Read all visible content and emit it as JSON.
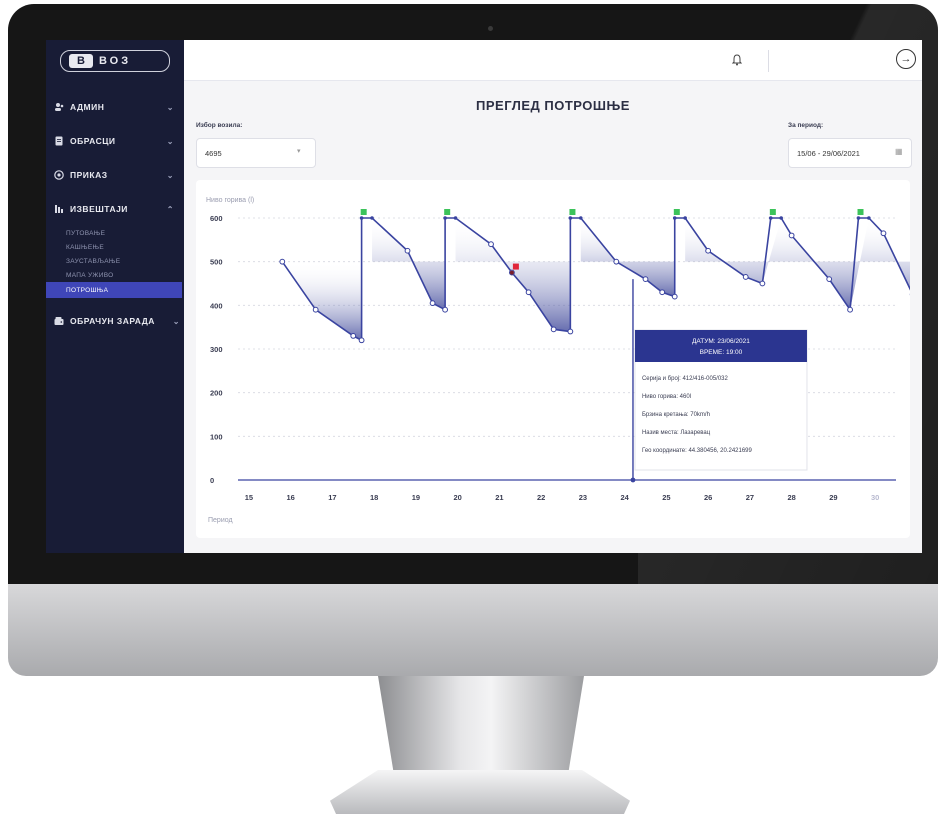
{
  "sidebar": {
    "logo_text": "ВОЗ",
    "items": [
      {
        "label": "АДМИН",
        "icon": "users-icon"
      },
      {
        "label": "ОБРАСЦИ",
        "icon": "document-icon"
      },
      {
        "label": "ПРИКАЗ",
        "icon": "eye-icon"
      },
      {
        "label": "ИЗВЕШТАЈИ",
        "icon": "report-icon"
      },
      {
        "label": "ОБРАЧУН ЗАРАДА",
        "icon": "wallet-icon"
      }
    ],
    "subitems": [
      "ПУТОВАЊЕ",
      "КАШЊЕЊЕ",
      "ЗАУСТАВЉАЊЕ",
      "МАПА УЖИВО",
      "ПОТРОШЊА"
    ],
    "active_subitem": "ПОТРОШЊА"
  },
  "header": {
    "title": "ПРЕГЛЕД ПОТРОШЊЕ",
    "vehicle_label": "Избор возила:",
    "vehicle_value": "4695",
    "period_label": "За период:",
    "period_value": "15/06 - 29/06/2021"
  },
  "colors": {
    "sidebar": "#181c36",
    "accent": "#3f46b8",
    "line": "#3a44a0"
  },
  "chart_data": {
    "type": "line",
    "ylabel": "Ниво горива (l)",
    "xlabel": "Период",
    "ylim": [
      0,
      600
    ],
    "yticks": [
      0,
      100,
      200,
      300,
      400,
      500,
      600
    ],
    "x_ticks": [
      "15",
      "16",
      "17",
      "18",
      "19",
      "20",
      "21",
      "22",
      "23",
      "24",
      "25",
      "26",
      "27",
      "28",
      "29",
      "30"
    ],
    "grid": "horizontal dotted",
    "series": [
      {
        "points": [
          [
            15.8,
            500
          ],
          [
            16.6,
            390
          ],
          [
            17.5,
            330
          ],
          [
            17.7,
            320
          ],
          [
            17.7,
            600
          ],
          [
            17.95,
            600
          ],
          [
            18.8,
            525
          ],
          [
            19.4,
            405
          ],
          [
            19.7,
            390
          ],
          [
            19.7,
            600
          ],
          [
            19.95,
            600
          ],
          [
            20.8,
            540
          ],
          [
            21.3,
            475
          ],
          [
            21.7,
            430
          ],
          [
            22.3,
            345
          ],
          [
            22.7,
            340
          ],
          [
            22.7,
            600
          ],
          [
            22.95,
            600
          ],
          [
            23.8,
            500
          ],
          [
            24.5,
            460
          ],
          [
            24.9,
            430
          ],
          [
            25.2,
            420
          ],
          [
            25.2,
            600
          ],
          [
            25.45,
            600
          ],
          [
            26.0,
            525
          ],
          [
            26.9,
            465
          ],
          [
            27.3,
            450
          ],
          [
            27.5,
            600
          ],
          [
            27.75,
            600
          ],
          [
            28.0,
            560
          ],
          [
            28.9,
            460
          ],
          [
            29.4,
            390
          ],
          [
            29.6,
            600
          ],
          [
            29.85,
            600
          ],
          [
            30.2,
            565
          ],
          [
            30.9,
            425
          ]
        ]
      }
    ],
    "refuel_markers_x": [
      17.75,
      19.75,
      22.75,
      25.25,
      27.55,
      29.65
    ],
    "alert_marker": [
      21.3,
      475
    ],
    "selected_x": 24.2,
    "tooltip": {
      "title_line1": "ДАТУМ: 23/06/2021",
      "title_line2": "ВРЕМЕ: 19:00",
      "rows": [
        "Серија и број: 412/416-005/032",
        "Ниво горива: 460l",
        "Брзина кретања: 70km/h",
        "Назив места: Лазаревац",
        "Гео координате: 44.380456, 20.2421699"
      ]
    }
  }
}
